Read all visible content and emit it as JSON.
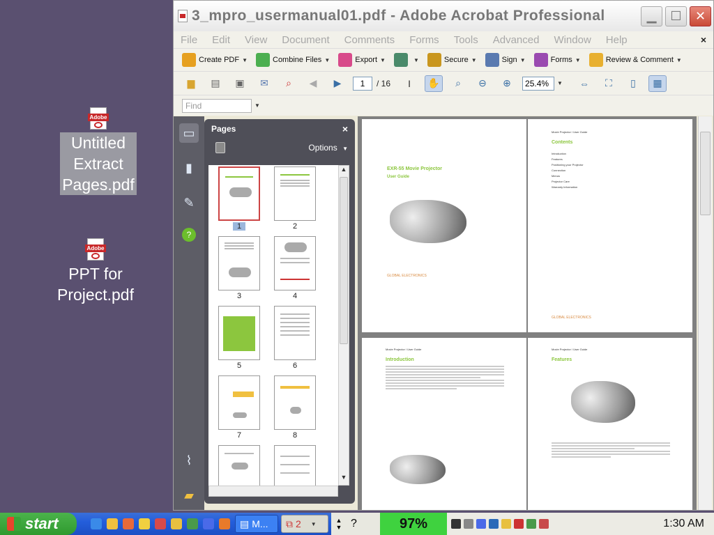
{
  "desktop": {
    "icons": [
      {
        "label_lines": [
          "Untitled",
          "Extract",
          "Pages.pdf"
        ],
        "badge": "Adobe"
      },
      {
        "label_lines": [
          "PPT for",
          "Project.pdf"
        ],
        "badge": "Adobe"
      }
    ]
  },
  "window": {
    "title": "3_mpro_usermanual01.pdf - Adobe Acrobat Professional",
    "menu": [
      "File",
      "Edit",
      "View",
      "Document",
      "Comments",
      "Forms",
      "Tools",
      "Advanced",
      "Window",
      "Help"
    ],
    "doc_close": "×",
    "tasks_toolbar": [
      {
        "label": "Create PDF",
        "icon": "create-pdf-icon",
        "color": "#e6a020"
      },
      {
        "label": "Combine Files",
        "icon": "combine-files-icon",
        "color": "#4caf50"
      },
      {
        "label": "Export",
        "icon": "export-icon",
        "color": "#d84a8a"
      },
      {
        "label": "",
        "icon": "secure-doc-icon",
        "color": "#4a8a6a"
      },
      {
        "label": "Secure",
        "icon": "lock-icon",
        "color": "#c9961e"
      },
      {
        "label": "Sign",
        "icon": "pen-icon",
        "color": "#5a7ab0"
      },
      {
        "label": "Forms",
        "icon": "forms-icon",
        "color": "#9a4ab0"
      },
      {
        "label": "Review & Comment",
        "icon": "review-icon",
        "color": "#e8b030"
      }
    ],
    "page_nav": {
      "current": "1",
      "total": "/ 16"
    },
    "zoom": "25.4%",
    "find_placeholder": "Find"
  },
  "pages_panel": {
    "title": "Pages",
    "close": "×",
    "options_label": "Options",
    "thumbnails": [
      "1",
      "2",
      "3",
      "4",
      "5",
      "6",
      "7",
      "8",
      "",
      ""
    ]
  },
  "document": {
    "page1": {
      "title": "EXR-55 Movie Projector",
      "subtitle": "User Guide",
      "brand": "GLOBAL ELECTRONICS"
    },
    "page2": {
      "header": "Movie Projector / User Guide",
      "title": "Contents",
      "toc": [
        "Introduction",
        "Features",
        "Positioning your Projector",
        "Connection",
        "Menus",
        "Projector Care",
        "Warranty Information"
      ]
    },
    "page3": {
      "header": "Movie Projector / User Guide",
      "title": "Introduction"
    },
    "page4": {
      "header": "Movie Projector / User Guide",
      "title": "Features"
    }
  },
  "taskbar": {
    "start_label": "start",
    "tasks": [
      {
        "label": "M...",
        "icon": "word-doc-icon"
      },
      {
        "label": "2",
        "icon": "acrobat-icon"
      }
    ],
    "battery": "97%",
    "clock": "1:30 AM"
  },
  "colors": {
    "accent_green": "#8cc63e",
    "acrobat_red": "#c8282a",
    "desktop_bg": "#5a5070"
  }
}
